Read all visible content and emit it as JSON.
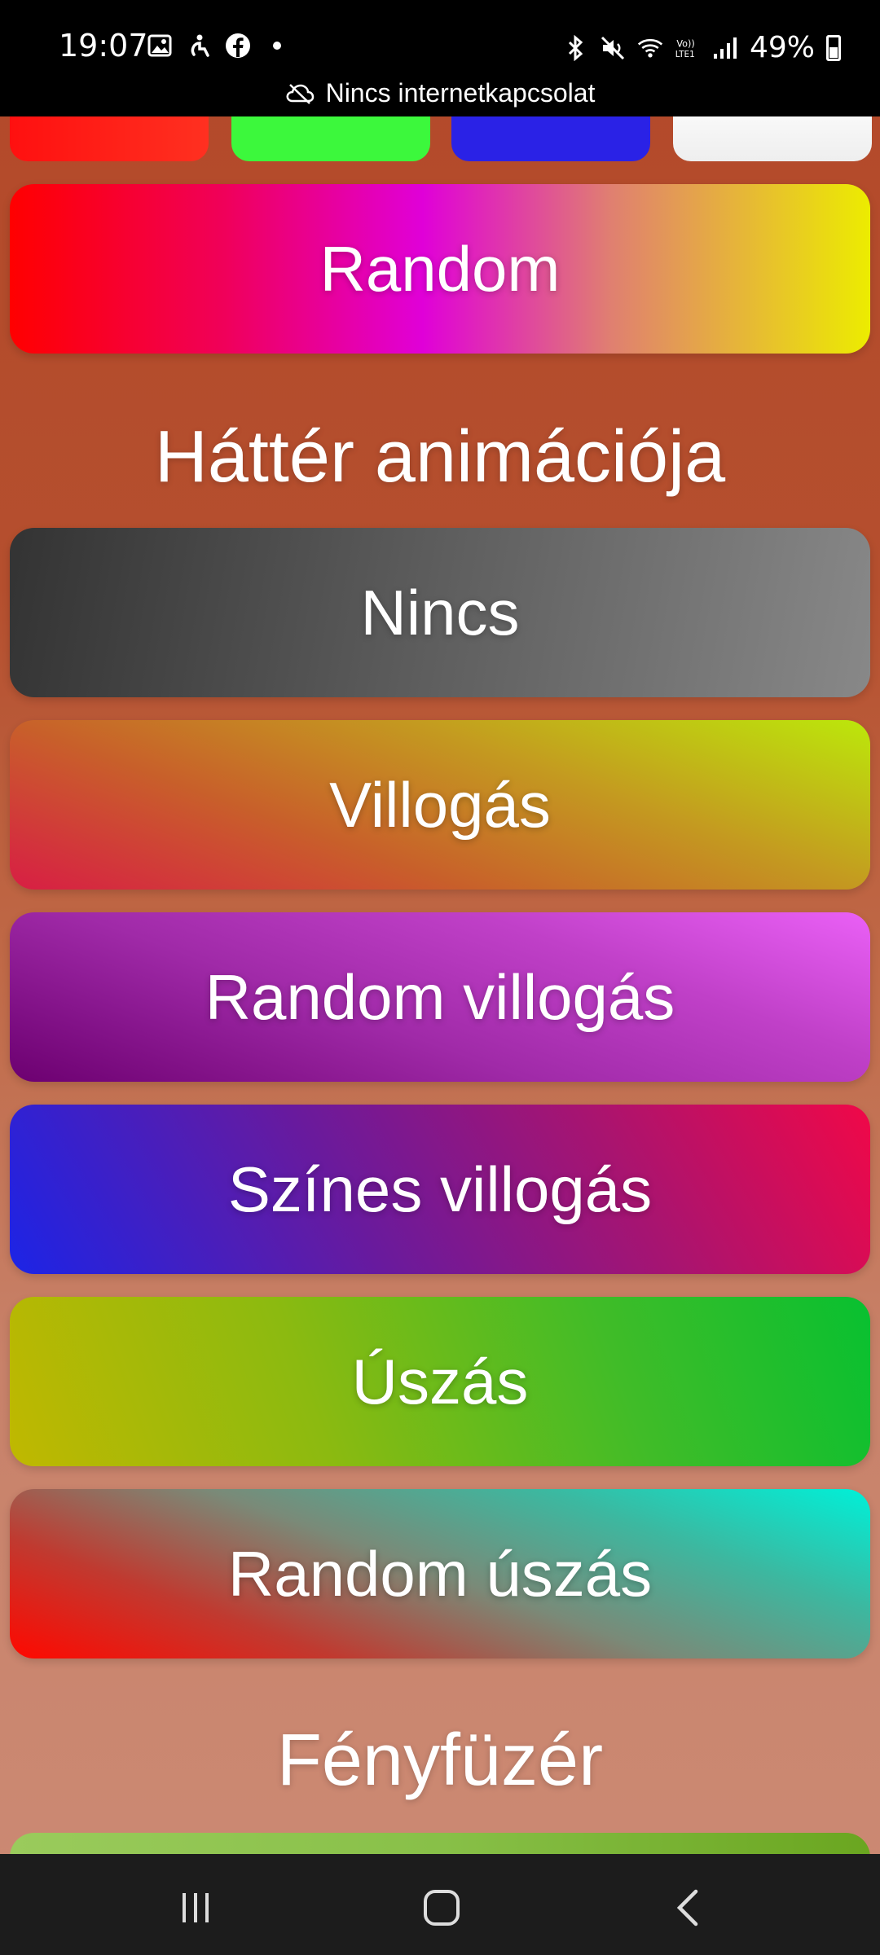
{
  "status_bar": {
    "time": "19:07",
    "battery": "49%",
    "network_banner": "Nincs internetkapcsolat",
    "left_icons": [
      "gallery-icon",
      "accessibility-icon",
      "facebook-icon",
      "dot-icon"
    ],
    "right_icons": [
      "bluetooth-icon",
      "mute-icon",
      "wifi-icon",
      "volte-icon",
      "signal-icon",
      "battery-icon"
    ]
  },
  "swatches": [
    {
      "name": "red",
      "color": "#ff1a1a"
    },
    {
      "name": "green",
      "color": "#3cf83c"
    },
    {
      "name": "blue",
      "color": "#2a22e6"
    },
    {
      "name": "white",
      "color": "#ffffff"
    }
  ],
  "buttons": {
    "random": "Random"
  },
  "animation_section": {
    "title": "Háttér animációja",
    "options": [
      "Nincs",
      "Villogás",
      "Random villogás",
      "Színes villogás",
      "Úszás",
      "Random úszás"
    ]
  },
  "lights_section": {
    "title": "Fényfüzér"
  },
  "nav_bar": {
    "icons": [
      "recents-icon",
      "home-icon",
      "back-icon"
    ]
  }
}
